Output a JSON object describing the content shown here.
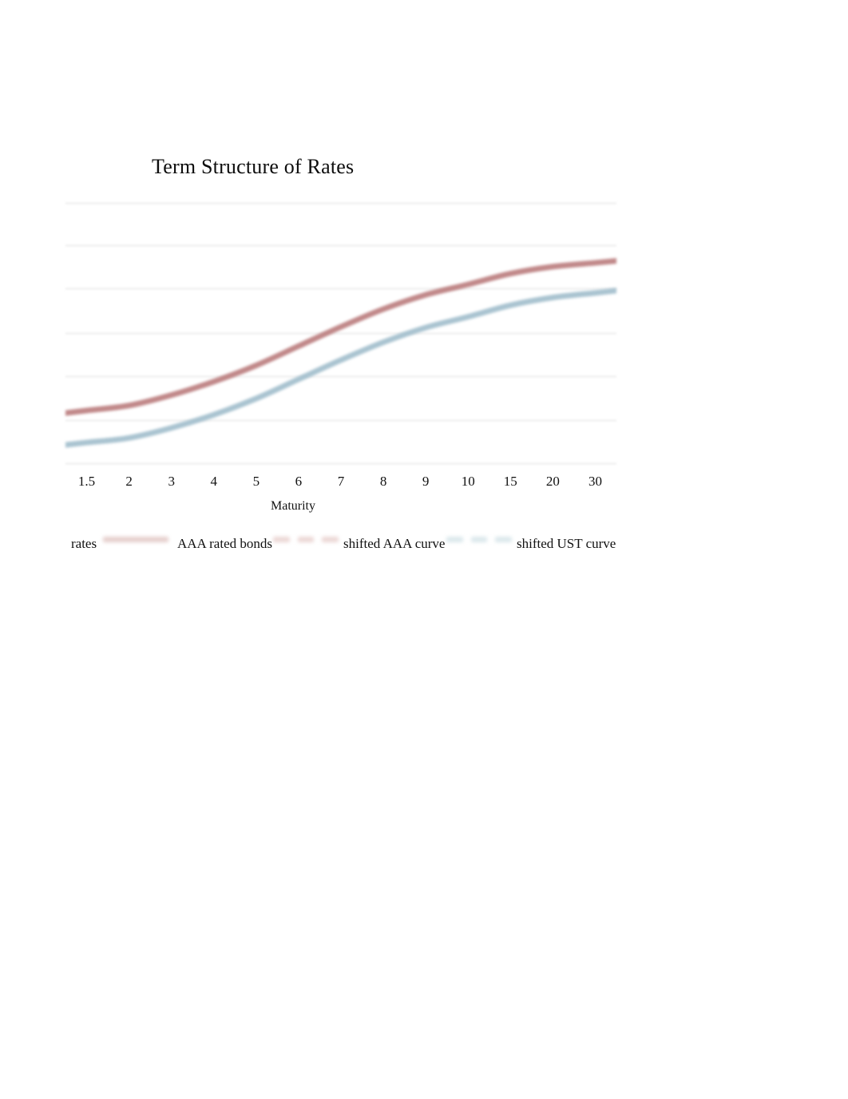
{
  "chart_data": {
    "type": "line",
    "title": "Term Structure of Rates",
    "xlabel": "Maturity",
    "ylabel": "",
    "grid": true,
    "gridline_count": 7,
    "legend_position": "bottom",
    "axis_y_labels_visible": false,
    "categories": [
      "1.5",
      "2",
      "3",
      "4",
      "5",
      "6",
      "7",
      "8",
      "9",
      "10",
      "15",
      "20",
      "30"
    ],
    "ylim": [
      0,
      7
    ],
    "series": [
      {
        "name": "shifted AAA curve",
        "color": "#bc7f80",
        "style": "solid",
        "values": [
          1.45,
          1.58,
          1.85,
          2.2,
          2.62,
          3.12,
          3.62,
          4.08,
          4.45,
          4.72,
          5.0,
          5.18,
          5.28
        ]
      },
      {
        "name": "shifted UST curve",
        "color": "#a3bfcd",
        "style": "solid",
        "values": [
          0.62,
          0.74,
          1.0,
          1.34,
          1.76,
          2.26,
          2.76,
          3.22,
          3.6,
          3.88,
          4.18,
          4.38,
          4.5
        ]
      }
    ]
  },
  "chart": {
    "title": "Term Structure of Rates",
    "x_axis": {
      "title": "Maturity",
      "ticks": [
        "1.5",
        "2",
        "3",
        "4",
        "5",
        "6",
        "7",
        "8",
        "9",
        "10",
        "15",
        "20",
        "30"
      ]
    },
    "colors": {
      "aaa_red": "#bc7f80",
      "ust_blue": "#a3bfcd",
      "gridline": "#f3f3f3",
      "background": "#ffffff"
    },
    "legend": {
      "items": [
        {
          "label": "rates",
          "swatch": "none",
          "color": ""
        },
        {
          "label": "AAA rated bonds",
          "swatch": "solid-line",
          "color": "#e6cfcd"
        },
        {
          "label": "shifted AAA curve",
          "swatch": "dashed-line",
          "color": "#ecd7d5"
        },
        {
          "label": "shifted UST curve",
          "swatch": "dashed-line",
          "color": "#dbe8ec"
        }
      ]
    }
  }
}
